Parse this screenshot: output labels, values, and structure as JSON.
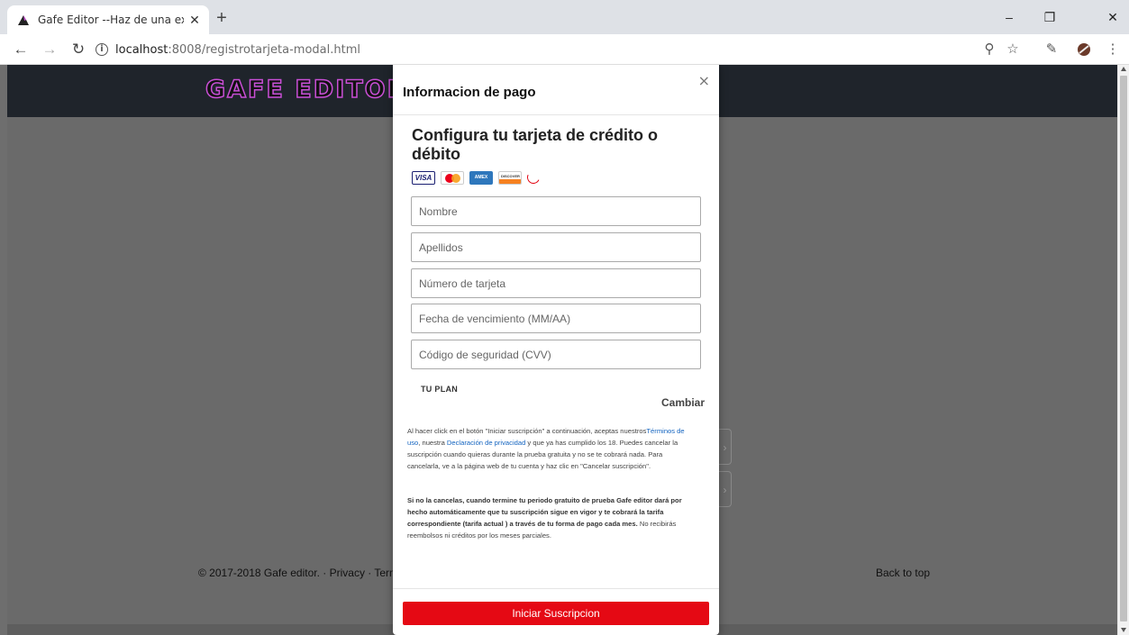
{
  "browser": {
    "tab_title": "Gafe Editor --Haz de una experie",
    "tab_close": "✕",
    "new_tab": "+",
    "url_host": "localhost",
    "url_path": ":8008/registrotarjeta-modal.html",
    "window_minimize": "–",
    "window_restore": "❐",
    "window_close": "✕"
  },
  "site": {
    "logo_text": "GAFE EDITOR",
    "footer_left": "© 2017-2018 Gafe editor. · Privacy · Term",
    "footer_right": "Back to top",
    "carousel_next": "›"
  },
  "modal": {
    "title": "Informacion de pago",
    "close": "×",
    "setup_title": "Configura tu tarjeta de crédito o débito",
    "cards": {
      "visa": "VISA",
      "amex": "AMEX",
      "discover": "DISCOVER"
    },
    "fields": {
      "first_name": "Nombre",
      "last_name": "Apellidos",
      "card_number": "Número de tarjeta",
      "expiry": "Fecha de vencimiento (MM/AA)",
      "cvv": "Código de seguridad (CVV)"
    },
    "plan_label": "TU PLAN",
    "plan_change": "Cambiar",
    "legal": {
      "p1_a": "Al hacer click en el botón \"Iniciar suscripción\" a continuación, aceptas nuestros",
      "terms_link": "Términos de uso",
      "p1_b": ", nuestra ",
      "privacy_link": "Declaración de privacidad",
      "p1_c": " y que ya has cumplido los 18. Puedes cancelar la suscripción cuando quieras durante la prueba gratuita y no se te cobrará nada. Para cancelarla, ve a la página web de tu cuenta y haz clic en \"Cancelar suscripción\".",
      "p2_bold": "Si no la cancelas, cuando termine tu periodo gratuito de prueba Gafe editor dará por hecho automáticamente que tu suscripción sigue en vigor y te cobrará la tarifa correspondiente (tarifa actual ) a través de tu forma de pago cada mes.",
      "p2_rest": " No recibirás reembolsos ni créditos por los meses parciales."
    },
    "submit": "Iniciar Suscripcion"
  },
  "colors": {
    "accent": "#e50914",
    "link": "#1565c0",
    "header_bg": "#1f242b",
    "overlay": "#6e6e6e"
  }
}
